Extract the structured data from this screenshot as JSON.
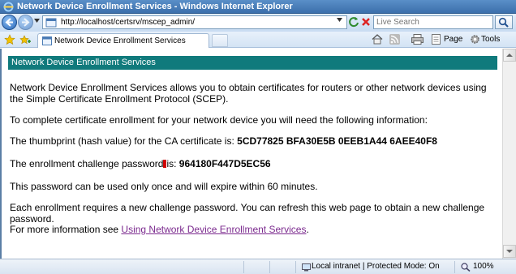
{
  "window": {
    "title": "Network Device Enrollment Services - Windows Internet Explorer"
  },
  "address_bar": {
    "url": "http://localhost/certsrv/mscep_admin/",
    "search_placeholder": "Live Search"
  },
  "tab": {
    "label": "Network Device Enrollment Services"
  },
  "command_bar": {
    "page_label": "Page",
    "tools_label": "Tools"
  },
  "page": {
    "header": "Network Device Enrollment Services",
    "intro": "Network Device Enrollment Services allows you to obtain certificates for routers or other network devices using the Simple Certificate Enrollment Protocol (SCEP).",
    "instructions": "To complete certificate enrollment for your network device you will need the following information:",
    "thumbprint_label": "The thumbprint (hash value) for the CA certificate is:",
    "thumbprint_value": "5CD77825 BFA30E5B 0EEB1A44 6AEE40F8",
    "password_label_before": "The enrollment challenge password",
    "password_label_after": "is:",
    "password_value": "964180F447D5EC56",
    "usage_note": "This password can be used only once and will expire within 60 minutes.",
    "refresh_note": "Each enrollment requires a new challenge password. You can refresh this web page to obtain a new challenge password.",
    "more_info_prefix": "For more information see",
    "more_info_link": "Using Network Device Enrollment Services",
    "more_info_suffix": "."
  },
  "status_bar": {
    "zone": "Local intranet | Protected Mode: On",
    "zoom": "100%"
  },
  "colors": {
    "header_band": "#107a7c",
    "link": "#7b2a8e",
    "titlebar": "#3b6fab"
  },
  "icons": [
    "ie-logo-icon",
    "back-icon",
    "forward-icon",
    "page-icon",
    "refresh-icon",
    "stop-icon",
    "search-icon",
    "favorites-star-icon",
    "add-favorites-icon",
    "home-icon",
    "feeds-icon",
    "print-icon",
    "page-menu-icon",
    "tools-gear-icon",
    "globe-intranet-icon",
    "zoom-icon"
  ]
}
